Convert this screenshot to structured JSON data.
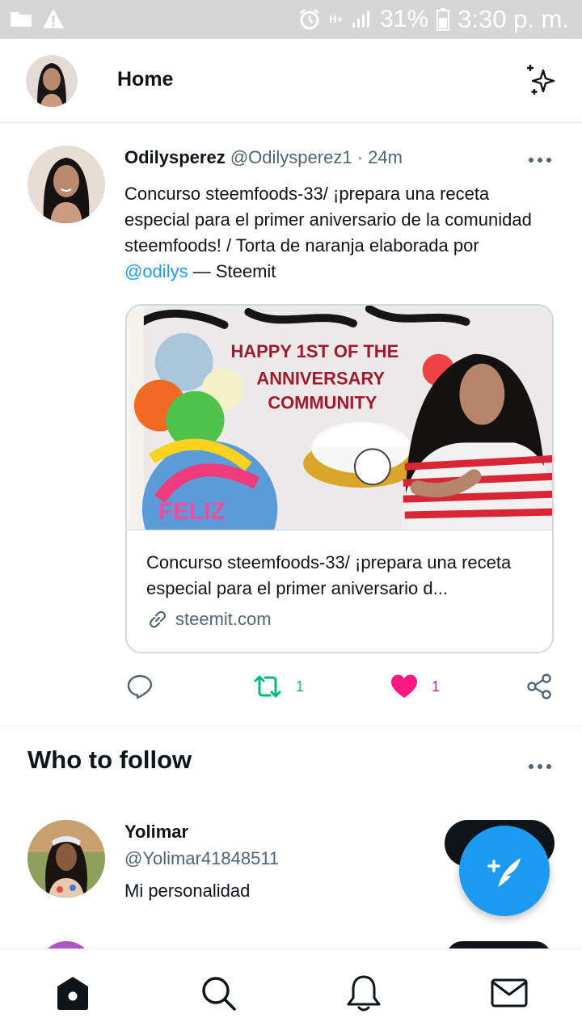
{
  "status_bar": {
    "network": "H+",
    "battery": "31%",
    "time": "3:30 p. m."
  },
  "header": {
    "title": "Home"
  },
  "tweet": {
    "display_name": "Odilysperez",
    "handle": "@Odilysperez1",
    "separator": "·",
    "time": "24m",
    "text_before": "Concurso steemfoods-33/ ¡prepara una receta especial para el primer aniversario de la comunidad steemfoods! / Torta de naranja elaborada por ",
    "mention": "@odilys",
    "text_after": " — Steemit",
    "card": {
      "title": "Concurso steemfoods-33/ ¡prepara una receta especial para el primer aniversario d...",
      "domain": "steemit.com",
      "image_banner_line1": "HAPPY 1ST OF THE",
      "image_banner_line2": "ANNIVERSARY",
      "image_banner_line3": "COMMUNITY"
    },
    "retweets": "1",
    "likes": "1",
    "colors": {
      "retweet": "#00ba7c",
      "like": "#f91880",
      "link": "#1d9bf0"
    }
  },
  "who_to_follow": {
    "title": "Who to follow",
    "user": {
      "name": "Yolimar",
      "handle": "@Yolimar41848511",
      "bio": "Mi personalidad"
    }
  },
  "icons": {
    "header": [
      "sparkle-icon"
    ],
    "actions": [
      "reply-icon",
      "retweet-icon",
      "heart-icon",
      "share-icon"
    ],
    "nav": [
      "home-icon",
      "search-icon",
      "bell-icon",
      "mail-icon"
    ],
    "fab": "compose-icon"
  }
}
